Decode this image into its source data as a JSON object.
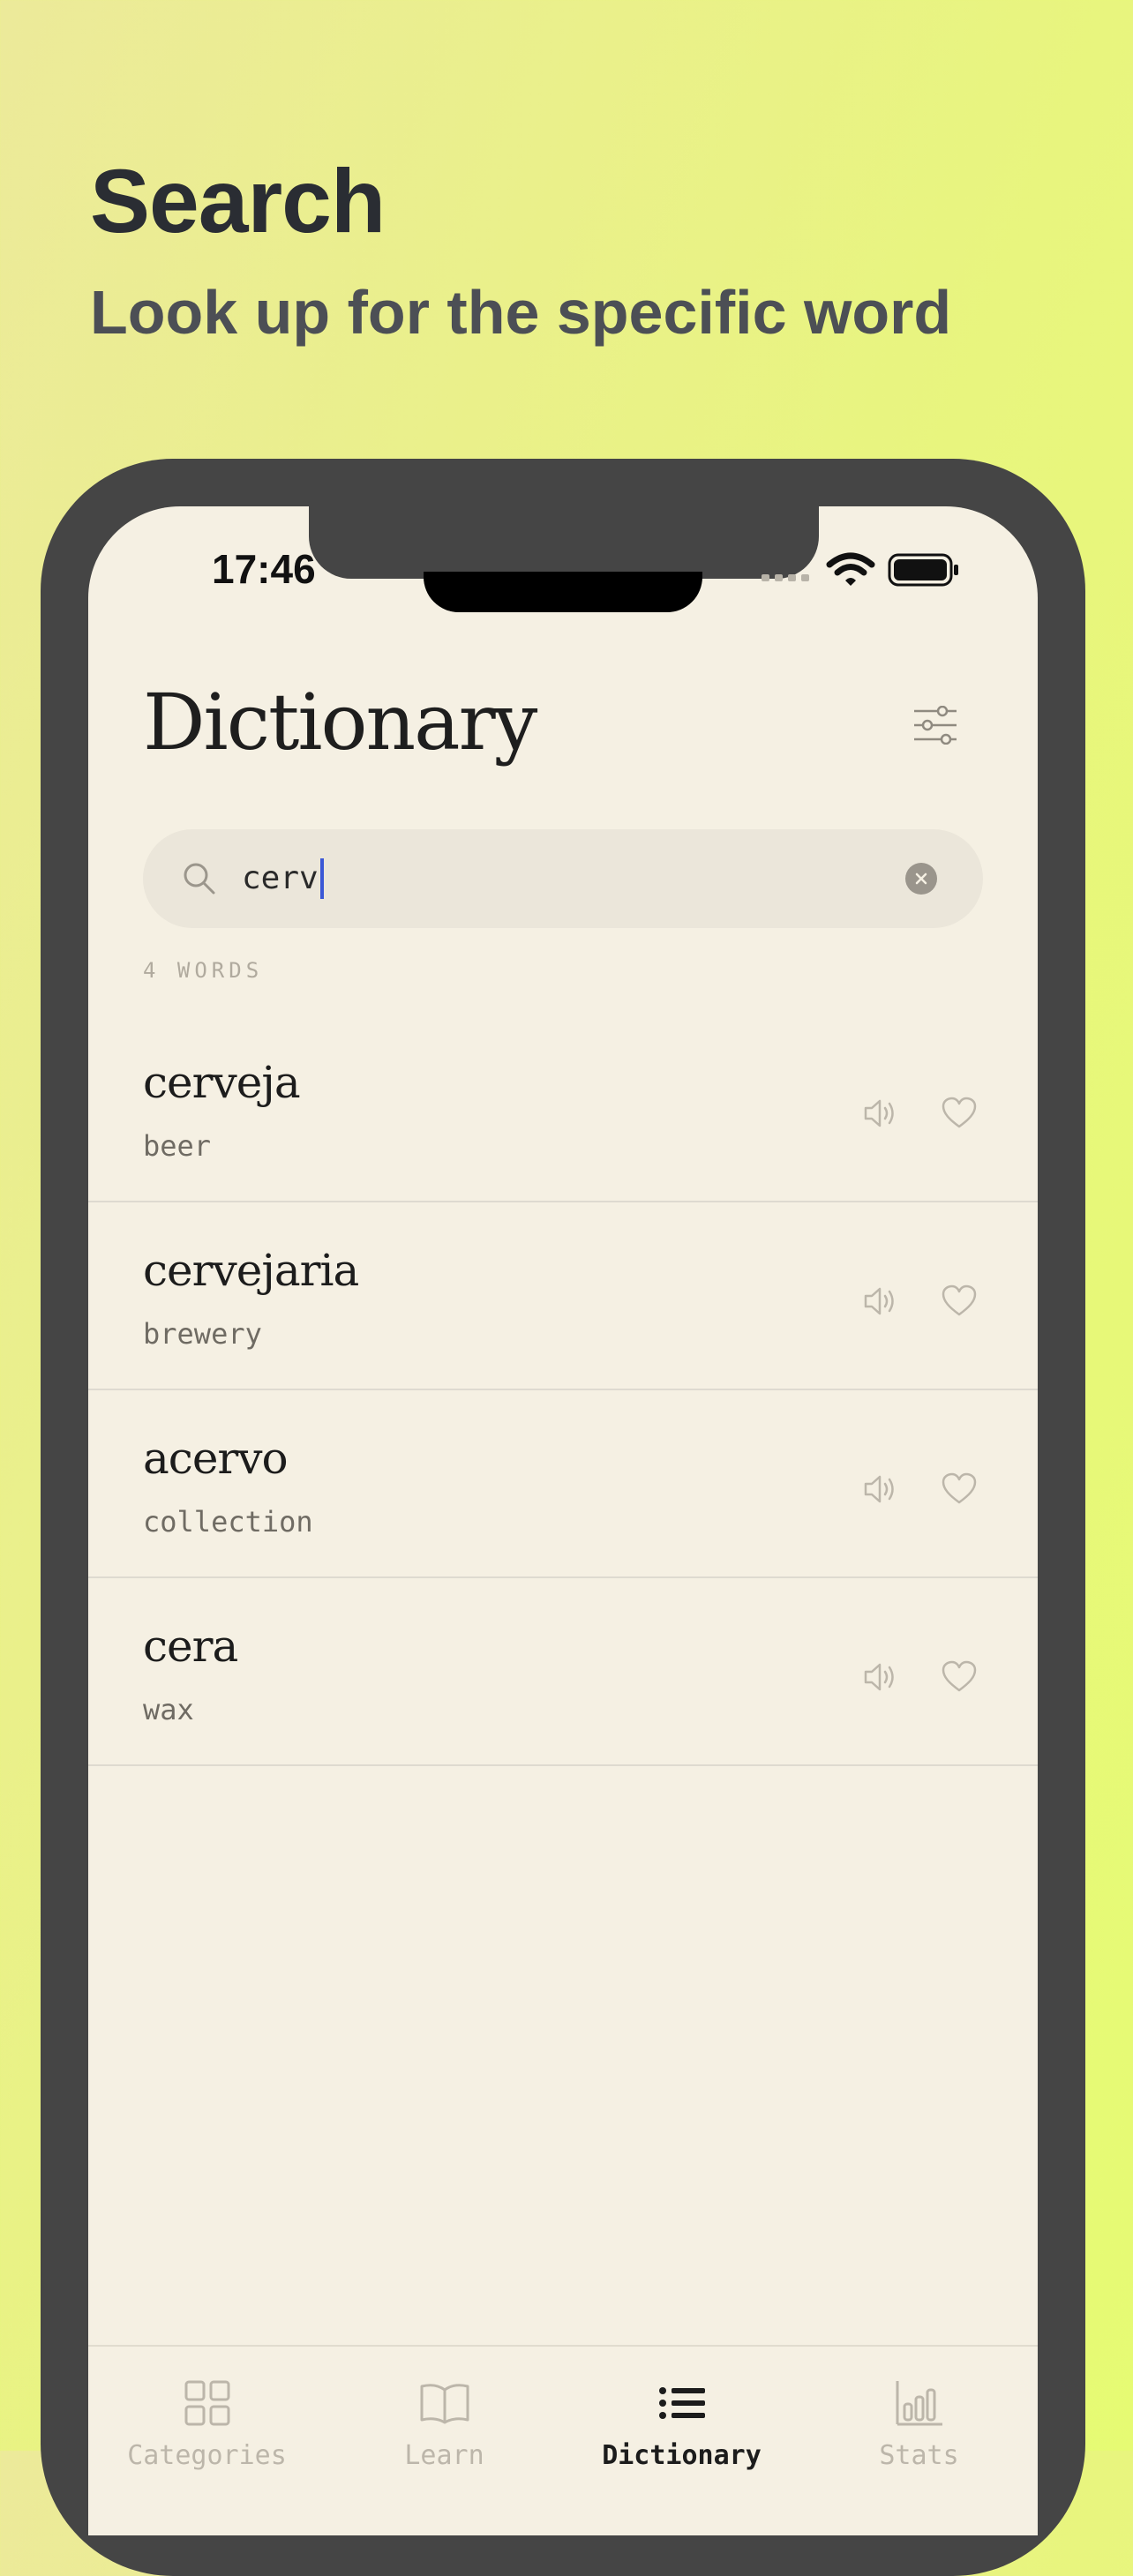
{
  "promo": {
    "title": "Search",
    "subtitle": "Look up for the specific word"
  },
  "status_bar": {
    "time": "17:46"
  },
  "header": {
    "title": "Dictionary"
  },
  "search": {
    "value": "cerv"
  },
  "results": {
    "count_label": "4 WORDS",
    "items": [
      {
        "term": "cerveja",
        "translation": "beer"
      },
      {
        "term": "cervejaria",
        "translation": "brewery"
      },
      {
        "term": "acervo",
        "translation": "collection"
      },
      {
        "term": "cera",
        "translation": "wax"
      }
    ]
  },
  "tab_bar": {
    "tabs": [
      {
        "label": "Categories",
        "icon": "grid-icon"
      },
      {
        "label": "Learn",
        "icon": "book-icon"
      },
      {
        "label": "Dictionary",
        "icon": "list-icon",
        "active": true
      },
      {
        "label": "Stats",
        "icon": "bar-chart-icon"
      }
    ]
  },
  "colors": {
    "accent_caret": "#3b58d6",
    "screen_background": "#f5f0e3",
    "search_background": "#ebe6da"
  }
}
